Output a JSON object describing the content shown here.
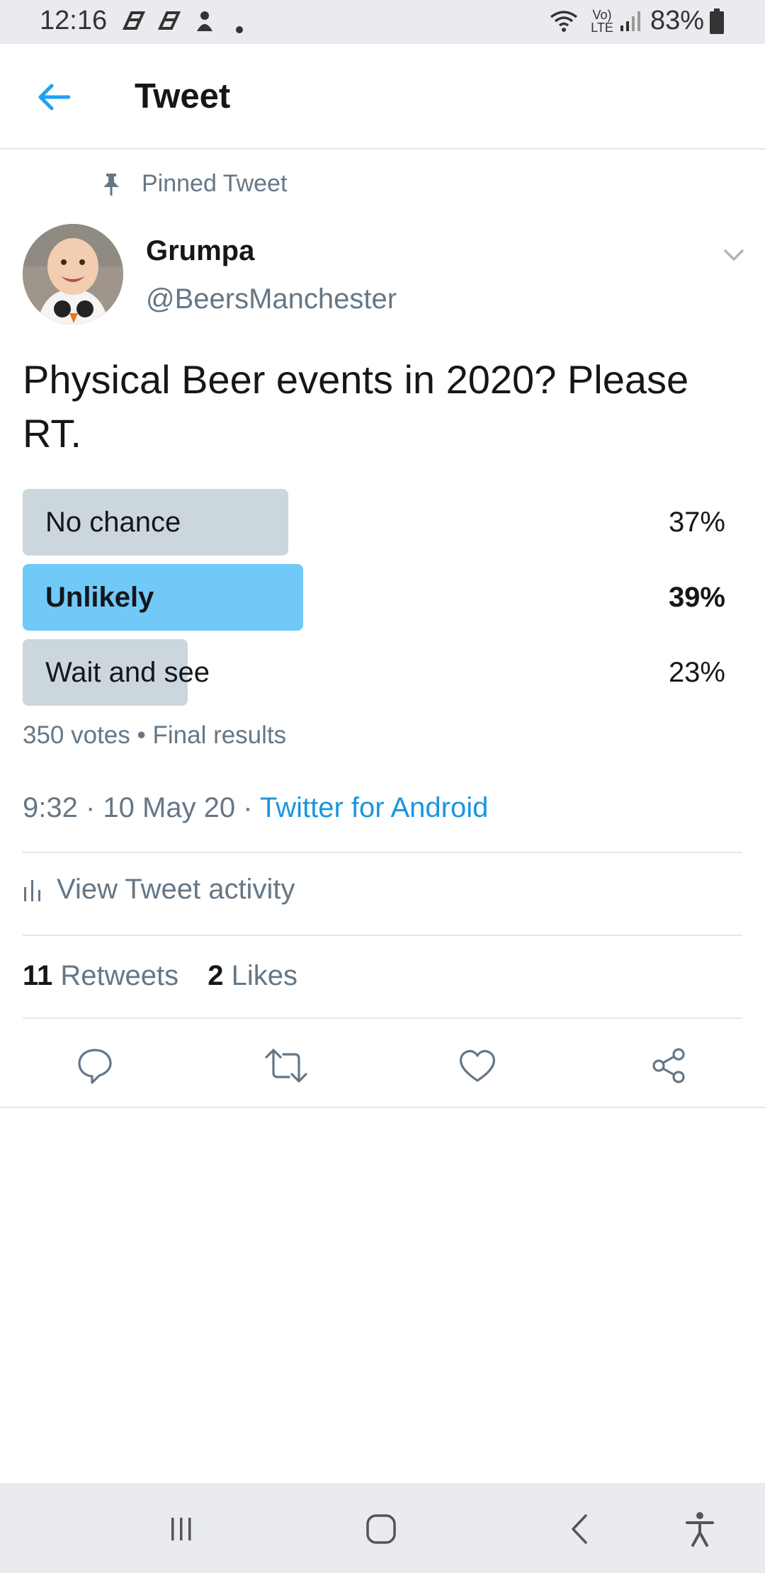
{
  "status_bar": {
    "time": "12:16",
    "network_label": "Vo) LTE",
    "battery": "83%",
    "icons": [
      "notification-icon",
      "notification-icon",
      "notification-icon",
      "dot-icon",
      "wifi-icon",
      "signal-icon",
      "battery-icon"
    ]
  },
  "header": {
    "title": "Tweet",
    "back_icon": "arrow-left-icon"
  },
  "pinned": {
    "label": "Pinned Tweet",
    "icon": "pin-icon"
  },
  "author": {
    "name": "Grumpa",
    "handle": "@BeersManchester"
  },
  "tweet": {
    "text": "Physical Beer events in 2020? Please RT."
  },
  "poll": {
    "options": [
      {
        "label": "No chance",
        "percent": "37%",
        "value": 37,
        "winner": false
      },
      {
        "label": "Unlikely",
        "percent": "39%",
        "value": 39,
        "winner": true
      },
      {
        "label": "Wait and see",
        "percent": "23%",
        "value": 23,
        "winner": false
      }
    ],
    "meta": "350 votes • Final results"
  },
  "timestamp": {
    "time": "9:32 · 10 May 20 · ",
    "source": "Twitter for Android"
  },
  "activity": {
    "label": "View Tweet activity"
  },
  "stats": {
    "retweets_count": "11",
    "retweets_label": "Retweets",
    "likes_count": "2",
    "likes_label": "Likes"
  },
  "colors": {
    "accent": "#1b95e0",
    "poll_bar": "#ccd6dd",
    "poll_winner": "#71c9f8",
    "muted_text": "#657786"
  }
}
